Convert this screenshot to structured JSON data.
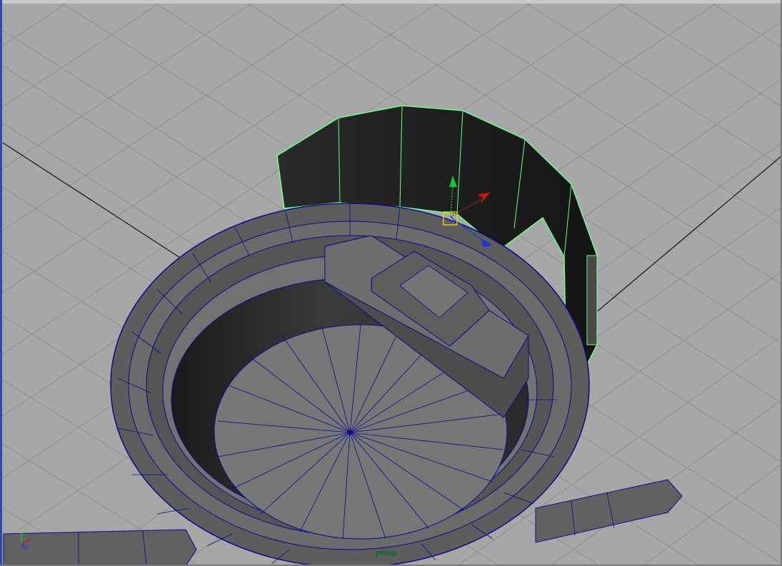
{
  "viewport": {
    "camera_label": "persp"
  },
  "colors": {
    "background": "#a7a7a7",
    "grid_line": "#8e8e8e",
    "axis_line": "#111111",
    "wireframe": "#0a0a8c",
    "selection": "#6dff8a",
    "manip_y": "#19c23a",
    "manip_x": "#c21a1a",
    "manip_z": "#1a3ad0",
    "pivot": "#e4d000"
  },
  "icons": {
    "axis_tripod": "axis-tripod-icon",
    "move_manipulator": "move-manipulator-icon"
  }
}
